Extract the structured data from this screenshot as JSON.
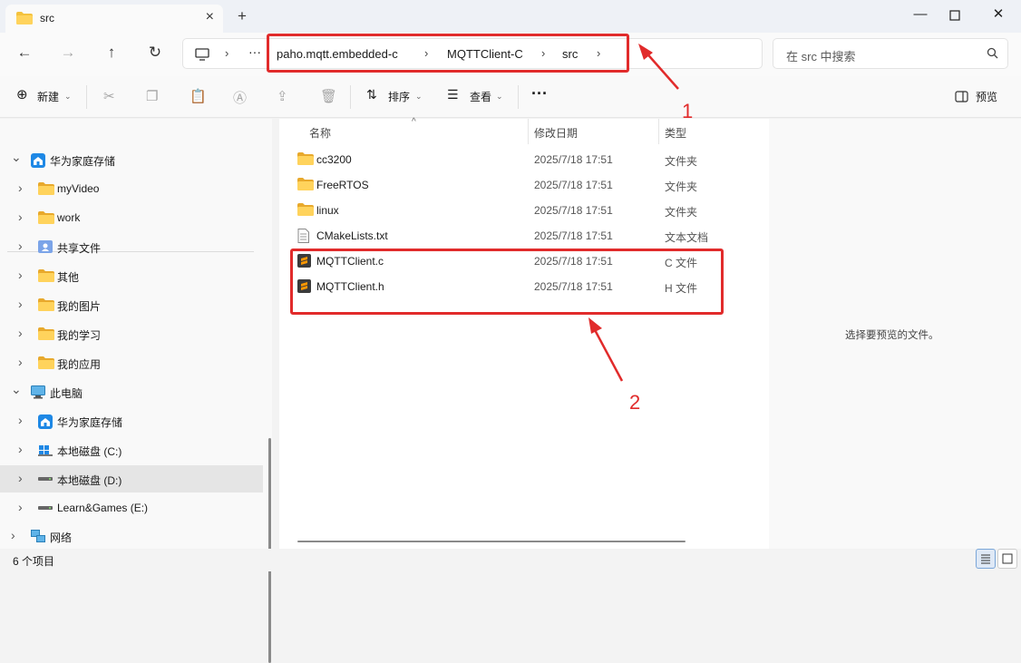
{
  "tab": {
    "title": "src"
  },
  "address": {
    "crumbs": [
      "paho.mqtt.embedded-c",
      "MQTTClient-C",
      "src"
    ],
    "overflow": "···"
  },
  "search": {
    "placeholder": "在 src 中搜索"
  },
  "toolbar": {
    "new_label": "新建",
    "sort_label": "排序",
    "view_label": "查看",
    "more": "···",
    "preview_label": "预览"
  },
  "sidebar": {
    "items": [
      {
        "label": "华为家庭存储",
        "icon": "home-storage-icon",
        "expanded": true
      },
      {
        "label": "myVideo",
        "icon": "folder-icon"
      },
      {
        "label": "work",
        "icon": "folder-icon"
      },
      {
        "label": "共享文件",
        "icon": "shared-folder-icon"
      },
      {
        "label": "其他",
        "icon": "folder-icon"
      },
      {
        "label": "我的图片",
        "icon": "folder-icon"
      },
      {
        "label": "我的学习",
        "icon": "folder-icon"
      },
      {
        "label": "我的应用",
        "icon": "folder-icon"
      },
      {
        "label": "此电脑",
        "icon": "computer-icon",
        "expanded": true
      },
      {
        "label": "华为家庭存储",
        "icon": "home-storage-icon"
      },
      {
        "label": "本地磁盘 (C:)",
        "icon": "windows-drive-icon"
      },
      {
        "label": "本地磁盘 (D:)",
        "icon": "drive-icon",
        "selected": true
      },
      {
        "label": "Learn&Games (E:)",
        "icon": "drive-icon"
      },
      {
        "label": "网络",
        "icon": "network-icon"
      }
    ]
  },
  "columns": {
    "name": "名称",
    "date": "修改日期",
    "type": "类型"
  },
  "files": [
    {
      "name": "cc3200",
      "date": "2025/7/18 17:51",
      "type": "文件夹",
      "icon": "folder-icon"
    },
    {
      "name": "FreeRTOS",
      "date": "2025/7/18 17:51",
      "type": "文件夹",
      "icon": "folder-icon"
    },
    {
      "name": "linux",
      "date": "2025/7/18 17:51",
      "type": "文件夹",
      "icon": "folder-icon"
    },
    {
      "name": "CMakeLists.txt",
      "date": "2025/7/18 17:51",
      "type": "文本文档",
      "icon": "text-file-icon"
    },
    {
      "name": "MQTTClient.c",
      "date": "2025/7/18 17:51",
      "type": "C 文件",
      "icon": "sublime-file-icon"
    },
    {
      "name": "MQTTClient.h",
      "date": "2025/7/18 17:51",
      "type": "H 文件",
      "icon": "sublime-file-icon"
    }
  ],
  "preview": {
    "message": "选择要预览的文件。"
  },
  "status": {
    "count": "6 个项目"
  },
  "annotations": {
    "label1": "1",
    "label2": "2"
  },
  "colors": {
    "accent_red": "#e12b2b",
    "folder": "#f4c23d",
    "selected_bg": "#e5e5e5"
  }
}
